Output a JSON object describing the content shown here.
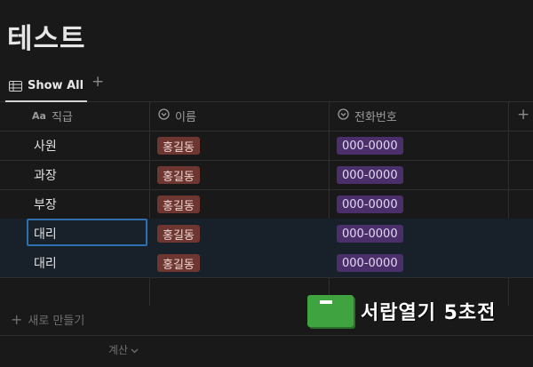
{
  "page": {
    "title": "테스트"
  },
  "tabs": [
    {
      "label": "Show All"
    }
  ],
  "table": {
    "columns": [
      {
        "label": "직급",
        "type_label": "Aa"
      },
      {
        "label": "이름"
      },
      {
        "label": "전화번호"
      }
    ],
    "rows": [
      {
        "rank": "사원",
        "name": "홍길동",
        "phone": "000-0000"
      },
      {
        "rank": "과장",
        "name": "홍길동",
        "phone": "000-0000"
      },
      {
        "rank": "부장",
        "name": "홍길동",
        "phone": "000-0000"
      },
      {
        "rank": "대리",
        "name": "홍길동",
        "phone": "000-0000"
      },
      {
        "rank": "대리",
        "name": "홍길동",
        "phone": "000-0000"
      }
    ],
    "new_row_label": "새로 만들기",
    "calculate_label": "계산"
  },
  "promo": {
    "text": "서랍열기 5초전"
  },
  "colors": {
    "background": "#191919",
    "name_tag": "#6e3630",
    "phone_tag": "#4a2f6b",
    "selection": "#2f6fae"
  }
}
